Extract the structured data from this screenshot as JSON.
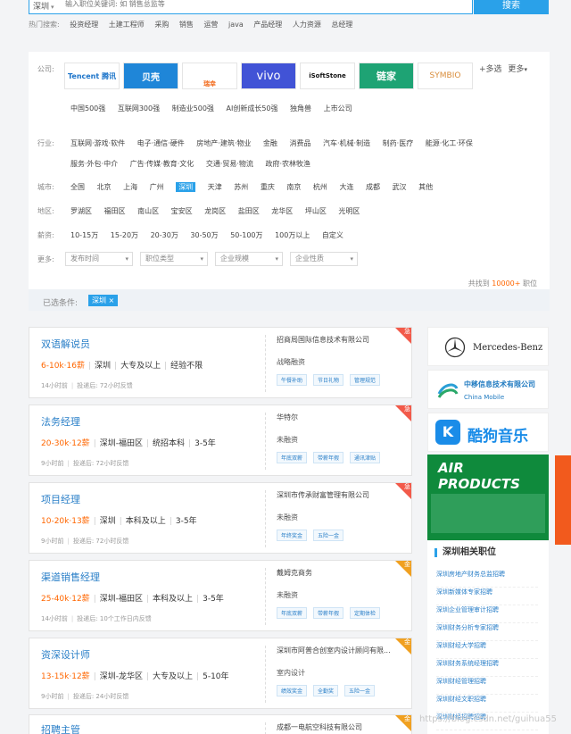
{
  "search": {
    "city": "深圳",
    "placeholder": "输入职位关键词: 如 销售总监等",
    "button": "搜索",
    "hot_label": "热门搜索:",
    "hot_keywords": [
      "投资经理",
      "土建工程师",
      "采购",
      "销售",
      "运营",
      "java",
      "产品经理",
      "人力资源",
      "总经理"
    ]
  },
  "filters": {
    "company_label": "公司:",
    "company_logos": [
      "Tencent 腾讯",
      "贝壳",
      "瑞幸",
      "vivo",
      "iSoftStone",
      "链家",
      "SYMBIO"
    ],
    "multi_select": "+多选",
    "more": "更多",
    "company_types": [
      "中国500强",
      "互联网300强",
      "制造业500强",
      "AI创新成长50强",
      "独角兽",
      "上市公司"
    ],
    "industry_label": "行业:",
    "industries_row1": [
      "互联网·游戏·软件",
      "电子·通信·硬件",
      "房地产·建筑·物业",
      "金融",
      "消费品",
      "汽车·机械·制造",
      "制药·医疗",
      "能源·化工·环保"
    ],
    "industries_row2": [
      "服务·外包·中介",
      "广告·传媒·教育·文化",
      "交通·贸易·物流",
      "政府·农林牧渔"
    ],
    "city_label": "城市:",
    "cities": [
      "全国",
      "北京",
      "上海",
      "广州",
      "深圳",
      "天津",
      "苏州",
      "重庆",
      "南京",
      "杭州",
      "大连",
      "成都",
      "武汉",
      "其他"
    ],
    "active_city": "深圳",
    "district_label": "地区:",
    "districts": [
      "罗湖区",
      "福田区",
      "南山区",
      "宝安区",
      "龙岗区",
      "盐田区",
      "龙华区",
      "坪山区",
      "光明区"
    ],
    "salary_label": "薪资:",
    "salaries": [
      "10-15万",
      "15-20万",
      "20-30万",
      "30-50万",
      "50-100万",
      "100万以上",
      "自定义"
    ],
    "more_label": "更多:",
    "dropdowns": [
      "发布时间",
      "职位类型",
      "企业规模",
      "企业性质"
    ],
    "found_prefix": "共找到",
    "found_count": "10000+",
    "found_suffix": "职位",
    "selected_label": "已选条件:",
    "selected_tag": "深圳 ×"
  },
  "jobs": [
    {
      "title": "双语解说员",
      "salary": "6-10k·16薪",
      "location": "深圳",
      "education": "大专及以上",
      "experience": "经验不限",
      "time": "14小时前",
      "feedback": "投递后: 72小时反馈",
      "company": "招商局国际信息技术有限公司",
      "stage": "战略融资",
      "benefits": [
        "午餐补助",
        "节日礼物",
        "管理规范"
      ],
      "badge": "急"
    },
    {
      "title": "法务经理",
      "salary": "20-30k·12薪",
      "location": "深圳-福田区",
      "education": "统招本科",
      "experience": "3-5年",
      "time": "9小时前",
      "feedback": "投递后: 72小时反馈",
      "company": "华特尔",
      "stage": "未融资",
      "benefits": [
        "年底双薪",
        "带薪年假",
        "通讯津贴"
      ],
      "badge": "急"
    },
    {
      "title": "项目经理",
      "salary": "10-20k·13薪",
      "location": "深圳",
      "education": "本科及以上",
      "experience": "3-5年",
      "time": "9小时前",
      "feedback": "投递后: 72小时反馈",
      "company": "深圳市传承财富管理有限公司",
      "stage": "未融资",
      "benefits": [
        "年终奖金",
        "五险一金"
      ],
      "badge": "急"
    },
    {
      "title": "渠道销售经理",
      "salary": "25-40k·12薪",
      "location": "深圳-福田区",
      "education": "本科及以上",
      "experience": "3-5年",
      "time": "14小时前",
      "feedback": "投递后: 10个工作日内反馈",
      "company": "戴姆克商务",
      "stage": "未融资",
      "benefits": [
        "年底双薪",
        "带薪年假",
        "定期体检"
      ],
      "badge": "金"
    },
    {
      "title": "资深设计师",
      "salary": "13-15k·12薪",
      "location": "深圳-龙华区",
      "education": "大专及以上",
      "experience": "5-10年",
      "time": "9小时前",
      "feedback": "投递后: 24小时反馈",
      "company": "深圳市阿普合创室内设计顾问有限...",
      "stage": "室内设计",
      "benefits": [
        "绩效奖金",
        "全勤奖",
        "五险一金"
      ],
      "badge": "金"
    },
    {
      "title": "招聘主管",
      "company": "成都一电航空科技有限公司",
      "badge": "金"
    }
  ],
  "sidebar": {
    "brands": [
      "Mercedes-Benz",
      "中移信息技术有限公司",
      "China Mobile",
      "酷狗音乐",
      "AIR PRODUCTS"
    ],
    "related_title": "深圳相关职位",
    "related_jobs": [
      "深圳房地产财务总监招聘",
      "深圳新媒体专家招聘",
      "深圳企业管理审计招聘",
      "深圳财务分析专家招聘",
      "深圳财经大学招聘",
      "深圳财务系统经理招聘",
      "深圳财经管理招聘",
      "深圳财经文职招聘",
      "深圳财经招聘招聘"
    ]
  },
  "watermark": "https://blog.csdn.net/guihua55",
  "colors": {
    "primary": "#2aa1e9",
    "salary": "#ff6600",
    "urgent": "#f25a4a",
    "gold": "#f0a020"
  }
}
